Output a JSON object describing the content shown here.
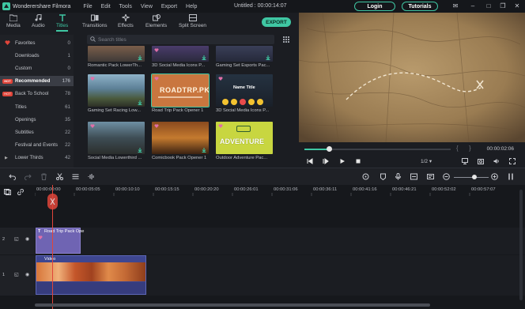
{
  "app": {
    "name": "Wonderershare Filmora",
    "menu": [
      "File",
      "Edit",
      "Tools",
      "View",
      "Export",
      "Help"
    ],
    "doc_title": "Untitled : 00:00:14:07",
    "login": "Login",
    "tutorials": "Tutorials"
  },
  "toolbar": {
    "tabs": [
      "Media",
      "Audio",
      "Titles",
      "Transitions",
      "Effects",
      "Elements",
      "Split Screen"
    ],
    "active": "Titles",
    "export": "EXPORT"
  },
  "sidebar": {
    "items": [
      {
        "label": "Favorites",
        "count": "0"
      },
      {
        "label": "Downloads",
        "count": "1"
      },
      {
        "label": "Custom",
        "count": "0"
      },
      {
        "label": "Recommended",
        "count": "176"
      },
      {
        "label": "Back To School",
        "count": "78"
      },
      {
        "label": "Titles",
        "count": "61"
      },
      {
        "label": "Openings",
        "count": "35"
      },
      {
        "label": "Subtitles",
        "count": "22"
      },
      {
        "label": "Festival and Events",
        "count": "22"
      },
      {
        "label": "Lower Thirds",
        "count": "42"
      }
    ],
    "hot_badge": "HOT"
  },
  "grid": {
    "search_placeholder": "Search titles",
    "items": [
      {
        "label": "Romantic Pack LowerTh...",
        "overlay": ""
      },
      {
        "label": "3D Social Media Icons P...",
        "overlay": ""
      },
      {
        "label": "Gaming Set Esports Pac...",
        "overlay": ""
      },
      {
        "label": "Gaming Set Racing Low...",
        "overlay": ""
      },
      {
        "label": "Road Trip Pack Opener 1",
        "overlay": "ROADTRP.PK"
      },
      {
        "label": "3D Social Media Icons P...",
        "overlay": "Name Title"
      },
      {
        "label": "Social Media Lowerthird ...",
        "overlay": ""
      },
      {
        "label": "Comicbook Pack Opener 1",
        "overlay": ""
      },
      {
        "label": "Outdoor Adventure Pac...",
        "overlay": "ADVENTURE"
      }
    ]
  },
  "preview": {
    "time": "00:00:02:06",
    "ratio": "1/2",
    "progress": 0.17
  },
  "timeline": {
    "ticks": [
      "00:00:00:00",
      "00:00:05:05",
      "00:00:10:10",
      "00:00:15:15",
      "00:00:20:20",
      "00:00:26:01",
      "00:00:31:06",
      "00:00:36:11",
      "00:00:41:16",
      "00:00:46:21",
      "00:00:52:02",
      "00:00:57:07"
    ],
    "title_clip": "Road Trip Pack Ope",
    "video_clip": "Video",
    "track2": "2",
    "track1": "1"
  },
  "colors": {
    "accent": "#3fc7a3",
    "hot": "#e0453a",
    "title_clip": "#6f64b3",
    "video_clip": "#3e4690"
  }
}
